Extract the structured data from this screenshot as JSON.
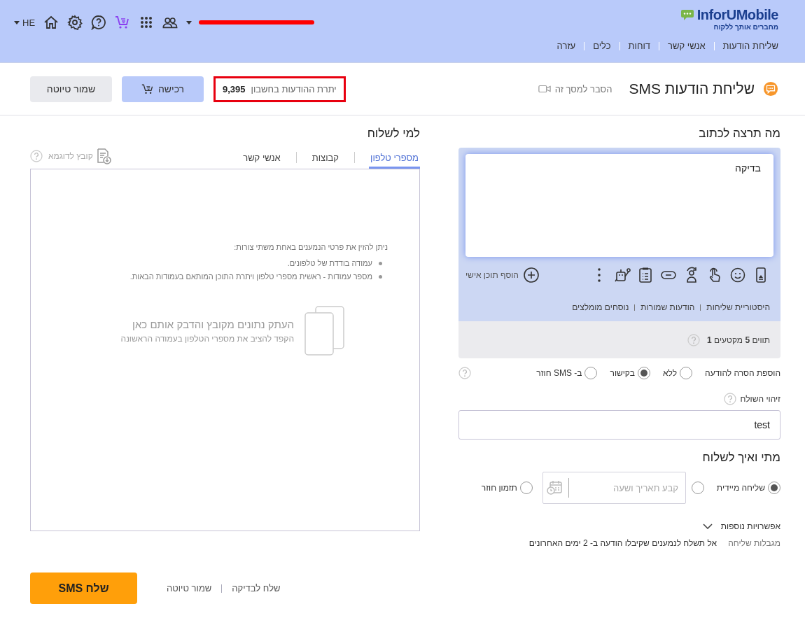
{
  "header": {
    "logo": {
      "name": "InforUMobile",
      "tagline": "מחברים אותך ללקוח"
    },
    "nav": [
      {
        "label": "שליחת הודעות"
      },
      {
        "label": "אנשי קשר"
      },
      {
        "label": "דוחות"
      },
      {
        "label": "כלים"
      },
      {
        "label": "עזרה"
      }
    ],
    "language": "HE"
  },
  "page": {
    "title": "שליחת הודעות SMS",
    "help_link": "הסבר למסך זה",
    "balance": {
      "label": "יתרת ההודעות בחשבון",
      "value": "9,395"
    },
    "buttons": [
      {
        "label": "רכישה",
        "kind": "primary"
      },
      {
        "label": "שמור טיוטה",
        "kind": "secondary"
      }
    ]
  },
  "compose": {
    "heading": "מה תרצה לכתוב",
    "message": "בדיקה",
    "add_personal": "הוסף תוכן אישי",
    "links": [
      "היסטוריית שליחות",
      "הודעות שמורות",
      "נוסחים מומלצים"
    ],
    "counter": "תווים **5** מקטעים **1**",
    "unsubscribe": {
      "label": "הוספת הסרה להודעה",
      "options": [
        {
          "label": "ללא",
          "selected": false
        },
        {
          "label": "בקישור",
          "selected": true
        },
        {
          "label": "ב- SMS חוזר",
          "selected": false
        }
      ]
    },
    "sender": {
      "label": "זיהוי השולח",
      "value": "test"
    }
  },
  "schedule": {
    "heading": "מתי ואיך לשלוח",
    "options": [
      {
        "kind": "plain",
        "label": "שליחה מיידית",
        "selected": true
      },
      {
        "kind": "datetime",
        "placeholder": "קבע תאריך ושעה",
        "selected": false
      },
      {
        "kind": "plain",
        "label": "תזמון חוזר",
        "selected": false
      }
    ],
    "more_options": "אפשרויות נוספות",
    "limits": {
      "label": "מגבלות שליחה",
      "text": "אל תשלח לנמענים שקיבלו הודעה ב- 2 ימים האחרונים"
    }
  },
  "recipients": {
    "heading": "למי לשלוח",
    "tabs": [
      {
        "label": "מספרי טלפון",
        "selected": true
      },
      {
        "label": "קבוצות",
        "selected": false
      },
      {
        "label": "אנשי קשר",
        "selected": false
      }
    ],
    "sample_file": "קובץ לדוגמא",
    "intro": "ניתן להזין את פרטי הנמענים באחת משתי צורות:",
    "bullets": [
      "עמודה בודדת של טלפונים.",
      "מספר עמודות - ראשית מספרי טלפון ויתרת התוכן המותאם בעמודות הבאות."
    ],
    "paste_title": "העתק נתונים מקובץ והדבק אותם כאן",
    "paste_hint": "הקפד להציב את מספרי הטלפון בעמודה הראשונה"
  },
  "footer": {
    "send": "שלח SMS",
    "links": [
      "שלח לבדיקה",
      "שמור טיוטה"
    ]
  }
}
